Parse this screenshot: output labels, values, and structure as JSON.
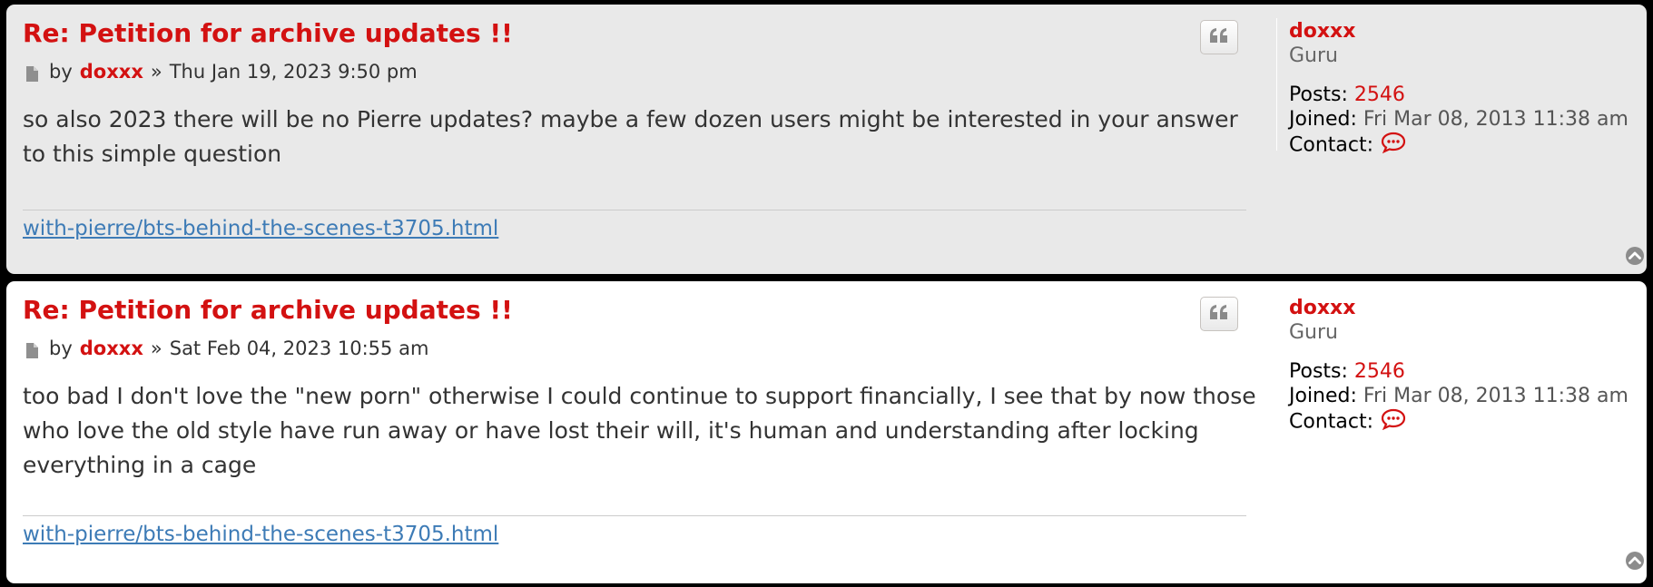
{
  "posts": [
    {
      "title": "Re: Petition for archive updates !!",
      "by_label": "by",
      "author": "doxxx",
      "separator": "»",
      "date": "Thu Jan 19, 2023 9:50 pm",
      "content": "so also 2023 there will be no Pierre updates? maybe a few dozen users might be interested in your answer to this simple question",
      "signature_link": "with-pierre/bts-behind-the-scenes-t3705.html",
      "profile": {
        "username": "doxxx",
        "rank": "Guru",
        "posts_label": "Posts:",
        "posts_value": "2546",
        "joined_label": "Joined:",
        "joined_value": "Fri Mar 08, 2013 11:38 am",
        "contact_label": "Contact:"
      }
    },
    {
      "title": "Re: Petition for archive updates !!",
      "by_label": "by",
      "author": "doxxx",
      "separator": "»",
      "date": "Sat Feb 04, 2023 10:55 am",
      "content": "too bad I don't love the \"new porn\" otherwise I could continue to support financially, I see that by now those who love the old style have run away or have lost their will, it's human and understanding after locking everything in a cage",
      "signature_link": "with-pierre/bts-behind-the-scenes-t3705.html",
      "profile": {
        "username": "doxxx",
        "rank": "Guru",
        "posts_label": "Posts:",
        "posts_value": "2546",
        "joined_label": "Joined:",
        "joined_value": "Fri Mar 08, 2013 11:38 am",
        "contact_label": "Contact:"
      }
    }
  ],
  "colors": {
    "accent": "#d31111",
    "link": "#3d7bb6",
    "post_bg_alt": "#e9e9e9",
    "post_bg": "#ffffff",
    "page_bg": "#000000"
  },
  "icons": {
    "quote": "quote-icon",
    "post_file": "file-icon",
    "contact": "chat-bubble-icon",
    "back_to_top": "chevron-circle-up-icon"
  }
}
